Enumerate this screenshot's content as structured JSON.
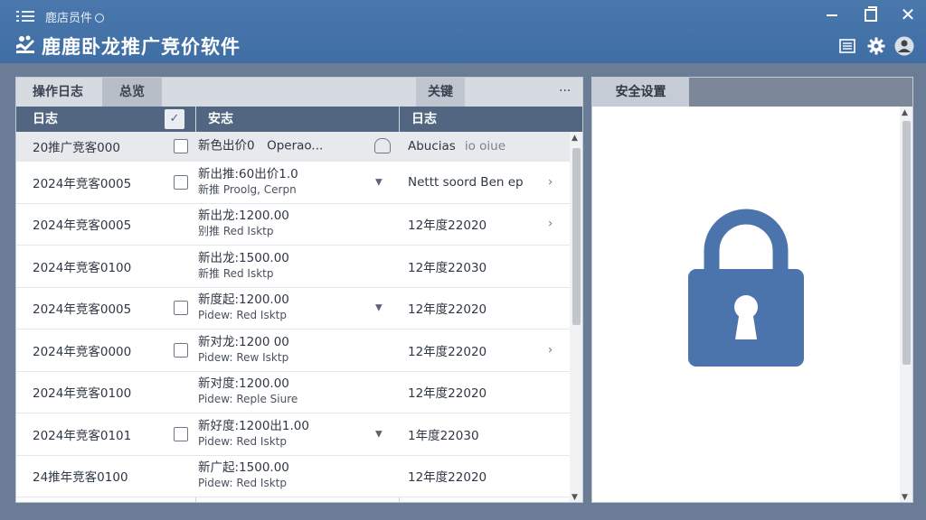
{
  "window": {
    "small_title": "鹿店员件",
    "app_title": "鹿鹿卧龙推广竞价软件",
    "close_glyph": "✕"
  },
  "icons": {
    "menu": "menu-icon",
    "logo": "app-logo-icon",
    "list": "list-icon",
    "gear": "gear-icon",
    "user": "user-avatar-icon",
    "lock": "lock-icon"
  },
  "left_panel": {
    "tabs": [
      "操作日志",
      "总览",
      "关键"
    ],
    "more": "···",
    "headers": {
      "a": "日志",
      "check": "✓",
      "b": "安志",
      "c": "日志"
    },
    "rows": [
      {
        "a": "20推广竞客000",
        "check": true,
        "b1": "新色出价0　Operao...",
        "b2": "",
        "lock": true,
        "c": "Abucias",
        "c_sub": "io oiue",
        "chev": false,
        "caret": false
      },
      {
        "a": "2024年竞客0005",
        "check": true,
        "b1": "新出推:60出价1.0",
        "b2": "新推 Proolg, Cerpn",
        "caret": true,
        "c": "Nettt soord Ben ep",
        "c_sub": "",
        "chev": true
      },
      {
        "a": "2024年竞客0005",
        "check": false,
        "b1": "新出龙:1200.00",
        "b2": "别推 Red Isktp",
        "caret": false,
        "c": "12年度22020",
        "c_sub": "",
        "chev": true
      },
      {
        "a": "2024年竞客0100",
        "check": false,
        "b1": "新出龙:1500.00",
        "b2": "新推 Red Isktp",
        "caret": false,
        "c": "12年度22030",
        "c_sub": "",
        "chev": false
      },
      {
        "a": "2024年竞客0005",
        "check": true,
        "b1": "新度起:1200.00",
        "b2": "Pidew: Red Isktp",
        "caret": true,
        "c": "12年度22020",
        "c_sub": "",
        "chev": false
      },
      {
        "a": "2024年竞客0000",
        "check": true,
        "b1": "新对龙:1200 00",
        "b2": "Pidew: Rew Isktp",
        "caret": false,
        "c": "12年度22020",
        "c_sub": "",
        "chev": true
      },
      {
        "a": "2024年竞客0100",
        "check": false,
        "b1": "新对度:1200.00",
        "b2": "Pidew: Reple Siure",
        "caret": false,
        "c": "12年度22020",
        "c_sub": "",
        "chev": false
      },
      {
        "a": "2024年竞客0101",
        "check": true,
        "b1": "新好度:1200出1.00",
        "b2": "Pidew: Red Isktp",
        "caret": true,
        "c": "1年度22030",
        "c_sub": "",
        "chev": false
      },
      {
        "a": "24推年竞客0100",
        "check": false,
        "b1": "新广起:1500.00",
        "b2": "Pidew: Red Isktp",
        "caret": false,
        "c": "12年度22020",
        "c_sub": "",
        "chev": false
      }
    ]
  },
  "right_panel": {
    "tab": "安全设置"
  },
  "colors": {
    "titlebar": "#3f6ea4",
    "table_header": "#536681",
    "lock": "#4a74ab"
  }
}
